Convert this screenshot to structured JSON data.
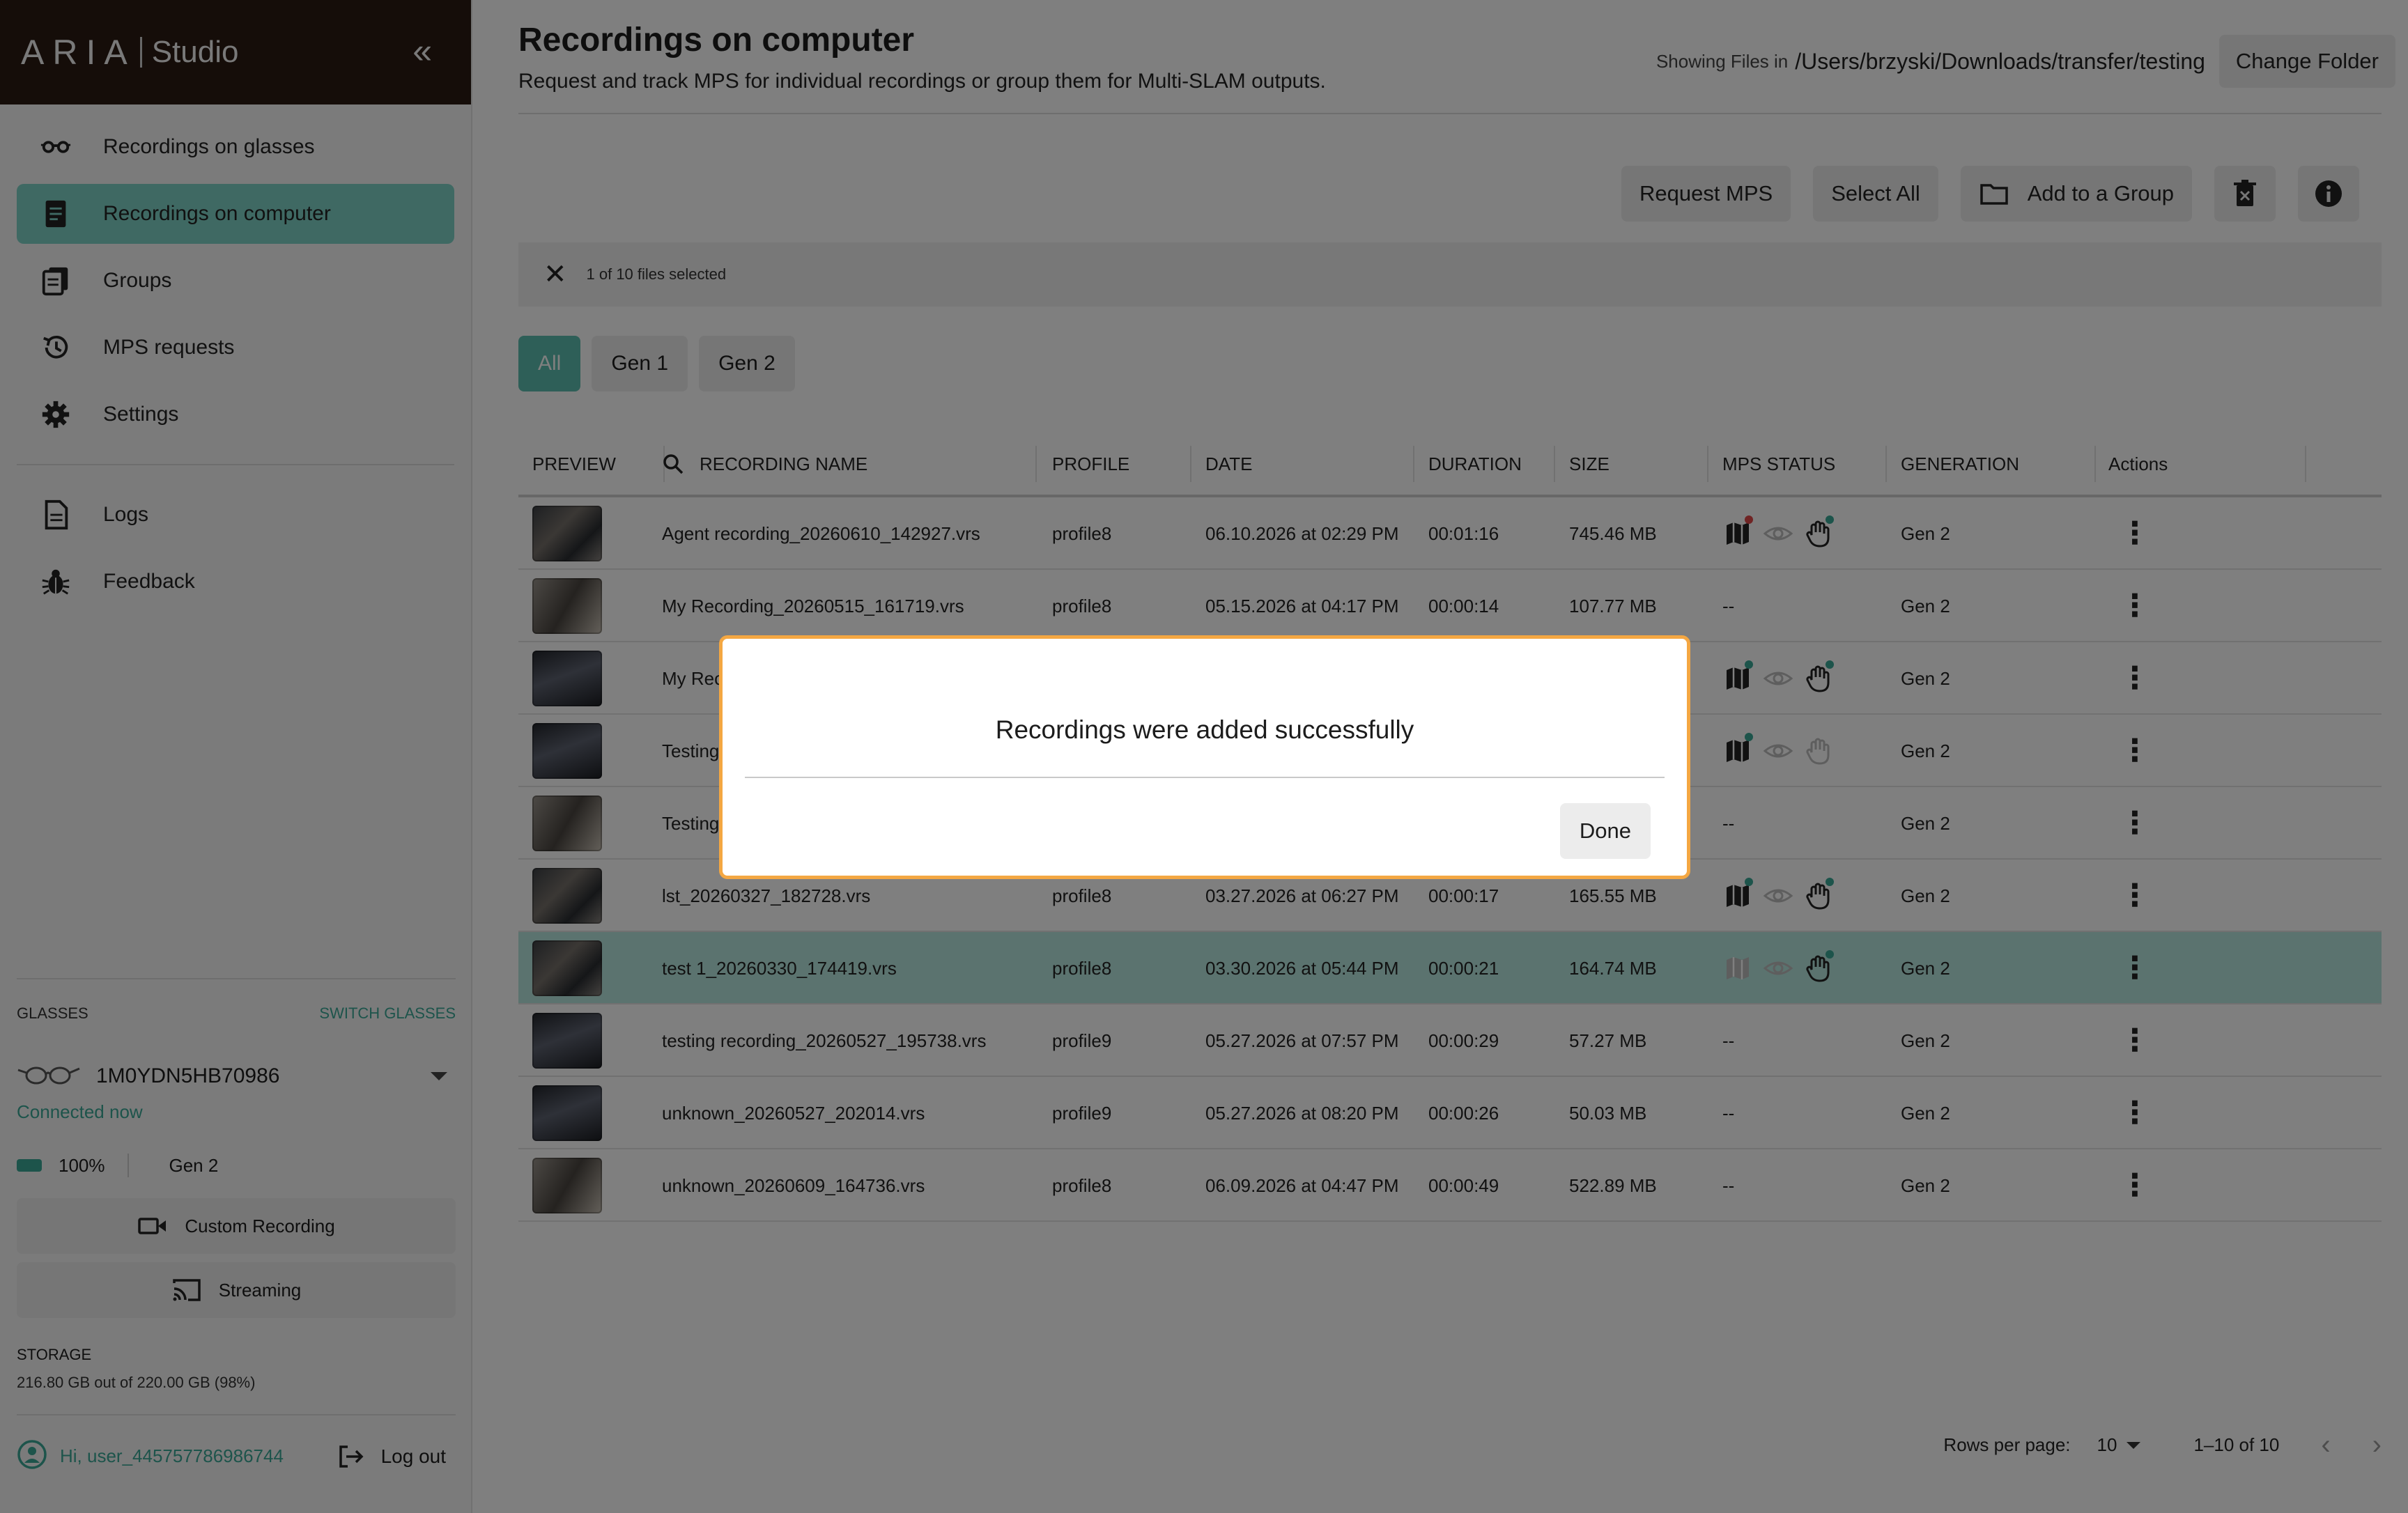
{
  "brand": {
    "name": "ARIA",
    "product": "Studio"
  },
  "sidebar": {
    "collapse_icon": "«",
    "nav": [
      {
        "label": "Recordings on glasses",
        "icon": "glasses-icon"
      },
      {
        "label": "Recordings on computer",
        "icon": "document-icon",
        "active": true
      },
      {
        "label": "Groups",
        "icon": "groups-icon"
      },
      {
        "label": "MPS requests",
        "icon": "history-icon"
      },
      {
        "label": "Settings",
        "icon": "gear-icon"
      }
    ],
    "nav_secondary": [
      {
        "label": "Logs",
        "icon": "file-icon"
      },
      {
        "label": "Feedback",
        "icon": "bug-icon"
      }
    ],
    "glasses": {
      "title": "GLASSES",
      "switch_label": "SWITCH GLASSES",
      "device_name": "1M0YDN5HB70986",
      "status": "Connected now",
      "battery": "100%",
      "generation": "Gen 2",
      "custom_recording_label": "Custom Recording",
      "streaming_label": "Streaming",
      "storage_title": "STORAGE",
      "storage_text": "216.80 GB out of 220.00 GB (98%)"
    },
    "user": {
      "greeting": "Hi, user_445757786986744",
      "logout_label": "Log out"
    }
  },
  "header": {
    "title": "Recordings on computer",
    "subtitle": "Request and track MPS for individual recordings or group them for Multi-SLAM outputs.",
    "folder_label": "Showing Files in",
    "folder_path": "/Users/brzyski/Downloads/transfer/testing",
    "change_folder_label": "Change Folder"
  },
  "toolbar": {
    "request_mps_label": "Request MPS",
    "select_all_label": "Select All",
    "add_group_label": "Add to a Group"
  },
  "selection": {
    "text": "1 of 10 files selected"
  },
  "filters": [
    "All",
    "Gen 1",
    "Gen 2"
  ],
  "table": {
    "headers": [
      "PREVIEW",
      "RECORDING NAME",
      "PROFILE",
      "DATE",
      "DURATION",
      "SIZE",
      "MPS STATUS",
      "GENERATION",
      "Actions"
    ],
    "rows": [
      {
        "name": "Agent recording_20260610_142927.vrs",
        "profile": "profile8",
        "date": "06.10.2026 at 02:29 PM",
        "duration": "00:01:16",
        "size": "745.46 MB",
        "mps": "icons",
        "map_dot": "#e04848",
        "hand_dot": "#3aa897",
        "hand_dim": false,
        "generation": "Gen 2"
      },
      {
        "name": "My Recording_20260515_161719.vrs",
        "profile": "profile8",
        "date": "05.15.2026 at 04:17 PM",
        "duration": "00:00:14",
        "size": "107.77 MB",
        "mps": "--",
        "generation": "Gen 2"
      },
      {
        "name": "My Rec",
        "profile": "",
        "date": "",
        "duration": "",
        "size": "",
        "mps": "icons",
        "map_dot": "#3aa897",
        "hand_dot": "#3aa897",
        "hand_dim": false,
        "generation": "Gen 2"
      },
      {
        "name": "Testing",
        "profile": "",
        "date": "",
        "duration": "",
        "size": "",
        "mps": "icons",
        "map_dot": "#3aa897",
        "hand_dot": "",
        "hand_dim": true,
        "generation": "Gen 2"
      },
      {
        "name": "Testing",
        "profile": "",
        "date": "",
        "duration": "",
        "size": "",
        "mps": "--",
        "generation": "Gen 2"
      },
      {
        "name": "lst_20260327_182728.vrs",
        "profile": "profile8",
        "date": "03.27.2026 at 06:27 PM",
        "duration": "00:00:17",
        "size": "165.55 MB",
        "mps": "icons",
        "map_dot": "#3aa897",
        "hand_dot": "#3aa897",
        "hand_dim": false,
        "generation": "Gen 2"
      },
      {
        "name": "test 1_20260330_174419.vrs",
        "profile": "profile8",
        "date": "03.30.2026 at 05:44 PM",
        "duration": "00:00:21",
        "size": "164.74 MB",
        "mps": "icons",
        "map_dot": "",
        "map_dim": true,
        "hand_dot": "#3aa897",
        "hand_dim": false,
        "generation": "Gen 2",
        "selected": true
      },
      {
        "name": "testing recording_20260527_195738.vrs",
        "profile": "profile9",
        "date": "05.27.2026 at 07:57 PM",
        "duration": "00:00:29",
        "size": "57.27 MB",
        "mps": "--",
        "generation": "Gen 2"
      },
      {
        "name": "unknown_20260527_202014.vrs",
        "profile": "profile9",
        "date": "05.27.2026 at 08:20 PM",
        "duration": "00:00:26",
        "size": "50.03 MB",
        "mps": "--",
        "generation": "Gen 2"
      },
      {
        "name": "unknown_20260609_164736.vrs",
        "profile": "profile8",
        "date": "06.09.2026 at 04:47 PM",
        "duration": "00:00:49",
        "size": "522.89 MB",
        "mps": "--",
        "generation": "Gen 2"
      }
    ]
  },
  "pagination": {
    "rows_label": "Rows per page:",
    "rows_value": "10",
    "range": "1–10 of 10"
  },
  "modal": {
    "message": "Recordings were added successfully",
    "done_label": "Done"
  },
  "colors": {
    "accent": "#7fd3c7",
    "accent_dark": "#3aa897",
    "brand_bg": "#2b1a13",
    "modal_border": "#f4a742",
    "error_dot": "#e04848"
  }
}
